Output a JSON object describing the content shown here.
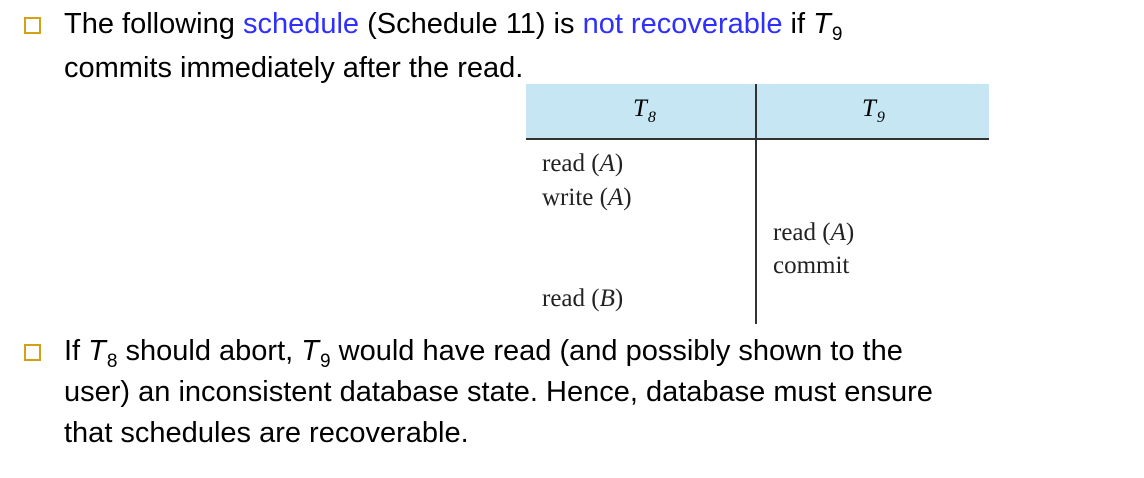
{
  "bullet1": {
    "t1": "The following ",
    "t2": "schedule",
    "t3": " (Schedule 11) is ",
    "t4": "not recoverable",
    "t5": " if ",
    "t6": "T",
    "t7": "9",
    "line2": "commits immediately after the read."
  },
  "table": {
    "col1": {
      "var": "T",
      "sub": "8"
    },
    "col2": {
      "var": "T",
      "sub": "9"
    },
    "ops": [
      {
        "col": "T8",
        "text": "read (A)",
        "pre": "read (",
        "arg": "A",
        "post": ")"
      },
      {
        "col": "T8",
        "text": "write (A)",
        "pre": "write (",
        "arg": "A",
        "post": ")"
      },
      {
        "col": "T9",
        "text": "read (A)",
        "pre": "read (",
        "arg": "A",
        "post": ")"
      },
      {
        "col": "T9",
        "text": "commit"
      },
      {
        "col": "T8",
        "text": "read (B)",
        "pre": "read (",
        "arg": "B",
        "post": ")"
      }
    ]
  },
  "bullet2": {
    "t1": "If ",
    "t2": "T",
    "t3": "8",
    "t4": " should abort, ",
    "t5": "T",
    "t6": "9",
    "t7": " would have read (and possibly shown to the",
    "line2": "user) an inconsistent database state. Hence, database must ensure",
    "line3": "that schedules are recoverable."
  },
  "colors": {
    "link": "#2f2fff",
    "bullet_box": "#d4a017",
    "table_header_bg": "#c5e6f2"
  }
}
